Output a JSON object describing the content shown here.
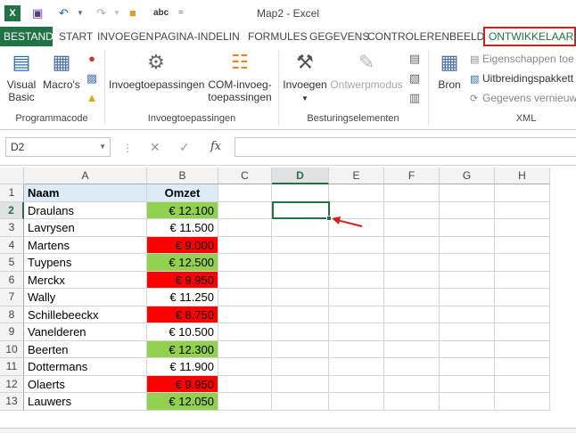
{
  "app": {
    "logo": "X",
    "title": "Map2 - Excel",
    "quick_access": [
      "save-icon",
      "undo-icon",
      "redo-icon",
      "folder-icon",
      "spelling-icon",
      "customize-icon"
    ],
    "spell_label": "abc"
  },
  "tabs": [
    {
      "label": "BESTAND",
      "kind": "file"
    },
    {
      "label": "START"
    },
    {
      "label": "INVOEGEN"
    },
    {
      "label": "PAGINA-INDELIN"
    },
    {
      "label": "FORMULES"
    },
    {
      "label": "GEGEVENS"
    },
    {
      "label": "CONTROLEREN"
    },
    {
      "label": "BEELD"
    },
    {
      "label": "ONTWIKKELAARS",
      "kind": "active",
      "highlight_color": "#d01f1f"
    }
  ],
  "ribbon": {
    "groups": {
      "code": {
        "label": "Programmacode",
        "visual_basic": {
          "line1": "Visual",
          "line2": "Basic"
        },
        "macros": "Macro's"
      },
      "addins": {
        "label": "Invoegtoepassingen",
        "addins_btn": "Invoegtoepassingen",
        "com_line1": "COM-invoeg-",
        "com_line2": "toepassingen"
      },
      "controls": {
        "label": "Besturingselementen",
        "insert": "Invoegen",
        "design_mode": "Ontwerpmodus"
      },
      "xml": {
        "label": "XML",
        "source": "Bron",
        "map_properties": "Eigenschappen toe",
        "expansion_packs": "Uitbreidingspakkett",
        "refresh_data": "Gegevens vernieuw"
      }
    }
  },
  "formula_bar": {
    "name_box": "D2",
    "fx": "fx",
    "value": ""
  },
  "sheet": {
    "columns": [
      "A",
      "B",
      "C",
      "D",
      "E",
      "F",
      "G",
      "H"
    ],
    "selected_column": "D",
    "selected_row": 2,
    "active_cell": "D2",
    "header": {
      "name": "Naam",
      "revenue": "Omzet"
    },
    "rows": [
      {
        "n": "1"
      },
      {
        "n": "2",
        "name": "Draulans",
        "revenue": "€ 12.100",
        "color": "green"
      },
      {
        "n": "3",
        "name": "Lavrysen",
        "revenue": "€ 11.500",
        "color": "none"
      },
      {
        "n": "4",
        "name": "Martens",
        "revenue": "€ 9.000",
        "color": "red"
      },
      {
        "n": "5",
        "name": "Tuypens",
        "revenue": "€ 12.500",
        "color": "green"
      },
      {
        "n": "6",
        "name": "Merckx",
        "revenue": "€ 9.950",
        "color": "red"
      },
      {
        "n": "7",
        "name": "Wally",
        "revenue": "€ 11.250",
        "color": "none"
      },
      {
        "n": "8",
        "name": "Schillebeeckx",
        "revenue": "€ 8.750",
        "color": "red"
      },
      {
        "n": "9",
        "name": "Vanelderen",
        "revenue": "€ 10.500",
        "color": "none"
      },
      {
        "n": "10",
        "name": "Beerten",
        "revenue": "€ 12.300",
        "color": "green"
      },
      {
        "n": "11",
        "name": "Dottermans",
        "revenue": "€ 11.900",
        "color": "none"
      },
      {
        "n": "12",
        "name": "Olaerts",
        "revenue": "€ 9.950",
        "color": "red"
      },
      {
        "n": "13",
        "name": "Lauwers",
        "revenue": "€ 12.050",
        "color": "green"
      }
    ],
    "colors": {
      "green": "#92d050",
      "red": "#ff0000",
      "header": "#ddebf7",
      "accent": "#217346",
      "annotation_arrow": "#d01f1f"
    }
  }
}
